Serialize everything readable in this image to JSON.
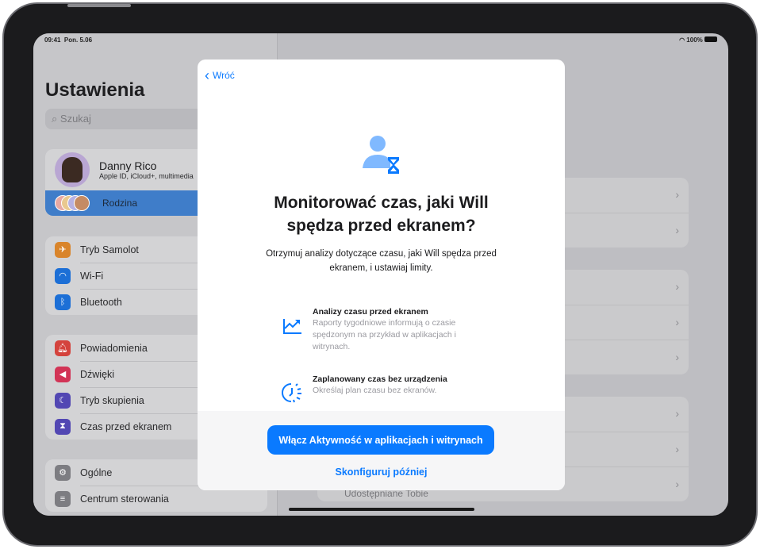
{
  "status_bar": {
    "time": "09:41",
    "date": "Pon. 5.06",
    "battery": "100%"
  },
  "sidebar": {
    "title": "Ustawienia",
    "search_placeholder": "Szukaj",
    "profile": {
      "name": "Danny Rico",
      "subtitle": "Apple ID, iCloud+, multimedia"
    },
    "family_label": "Rodzina",
    "group1": [
      {
        "label": "Tryb Samolot",
        "icon": "airplane-icon",
        "color": "#d9842a"
      },
      {
        "label": "Wi-Fi",
        "icon": "wifi-icon",
        "color": "#1c6fd6"
      },
      {
        "label": "Bluetooth",
        "icon": "bluetooth-icon",
        "color": "#1c6fd6"
      }
    ],
    "group2": [
      {
        "label": "Powiadomienia",
        "icon": "bell-icon",
        "color": "#d4433d"
      },
      {
        "label": "Dźwięki",
        "icon": "speaker-icon",
        "color": "#d23456"
      },
      {
        "label": "Tryb skupienia",
        "icon": "moon-icon",
        "color": "#5247b3"
      },
      {
        "label": "Czas przed ekranem",
        "icon": "hourglass-icon",
        "color": "#5247b3"
      }
    ],
    "group3": [
      {
        "label": "Ogólne",
        "icon": "gear-icon",
        "color": "#7d7d82"
      },
      {
        "label": "Centrum sterowania",
        "icon": "switches-icon",
        "color": "#7d7d82"
      }
    ]
  },
  "detail": {
    "partial_row_text": "Udostępniane Tobie"
  },
  "modal": {
    "back_label": "Wróć",
    "title": "Monitorować czas, jaki Will spędza przed ekranem?",
    "subtitle": "Otrzymuj analizy dotyczące czasu, jaki Will spędza przed ekranem, i ustawiaj limity.",
    "features": [
      {
        "title": "Analizy czasu przed ekranem",
        "description": "Raporty tygodniowe informują o czasie spędzonym na przykład w aplikacjach i witrynach.",
        "icon": "chart-up-icon"
      },
      {
        "title": "Zaplanowany czas bez urządzenia",
        "description": "Określaj plan czasu bez ekranów.",
        "icon": "downtime-icon"
      }
    ],
    "primary_button": "Włącz Aktywność w aplikacjach i witrynach",
    "secondary_button": "Skonfiguruj później",
    "accent": "#0a7aff"
  }
}
